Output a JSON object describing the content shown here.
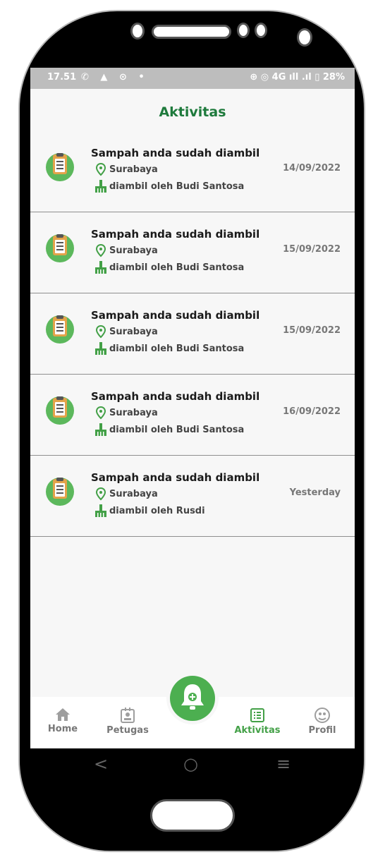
{
  "status_bar": {
    "time": "17.51",
    "left_icons": "✆ ▲ ⊙ •",
    "right_icons": "⊕ ◎ 4G ıll .ıl ▯ 28%"
  },
  "page_title": "Aktivitas",
  "activities": [
    {
      "title": "Sampah anda sudah diambil",
      "location": "Surabaya",
      "collector": "diambil oleh Budi Santosa",
      "date": "14/09/2022"
    },
    {
      "title": "Sampah anda sudah diambil",
      "location": "Surabaya",
      "collector": "diambil oleh Budi Santosa",
      "date": "15/09/2022"
    },
    {
      "title": "Sampah anda sudah diambil",
      "location": "Surabaya",
      "collector": "diambil oleh Budi Santosa",
      "date": "15/09/2022"
    },
    {
      "title": "Sampah anda sudah diambil",
      "location": "Surabaya",
      "collector": "diambil oleh Budi Santosa",
      "date": "16/09/2022"
    },
    {
      "title": "Sampah anda sudah diambil",
      "location": "Surabaya",
      "collector": "diambil oleh Rusdi",
      "date": "Yesterday"
    }
  ],
  "bottom_nav": {
    "home": "Home",
    "petugas": "Petugas",
    "aktivitas": "Aktivitas",
    "profil": "Profil",
    "active": "aktivitas"
  },
  "system_nav": {
    "back": "<",
    "home": "○",
    "recents": "≡"
  },
  "colors": {
    "accent": "#43a047",
    "title": "#1e7a3c",
    "status_bar": "#bdbdbd"
  },
  "icons": {
    "row": "clipboard-icon",
    "location": "location-pin-icon",
    "collector": "broom-icon",
    "fab": "bell-add-icon"
  }
}
